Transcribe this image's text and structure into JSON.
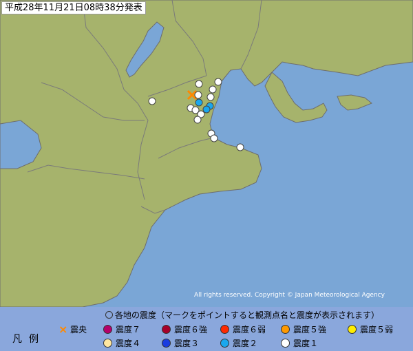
{
  "header": {
    "issued": "平成28年11月21日08時38分発表"
  },
  "copyright": "All rights reserved. Copyright © Japan Meteorological Agency",
  "legend": {
    "title": "各地の震度（マークをポイントすると観測点名と震度が表示されます）",
    "heading": "凡例",
    "epicenter_label": "震央",
    "items": [
      {
        "label": "震度７",
        "color": "#b5006a"
      },
      {
        "label": "震度６強",
        "color": "#a6002a"
      },
      {
        "label": "震度６弱",
        "color": "#ff2a00"
      },
      {
        "label": "震度５強",
        "color": "#ff9900"
      },
      {
        "label": "震度５弱",
        "color": "#ffee00"
      },
      {
        "label": "震度４",
        "color": "#ffe7a0"
      },
      {
        "label": "震度３",
        "color": "#1a3de0"
      },
      {
        "label": "震度２",
        "color": "#1aa7ee"
      },
      {
        "label": "震度１",
        "color": "#ffffff"
      }
    ]
  },
  "colors": {
    "sea": "#7aa6d6",
    "land": "#a6b36c",
    "border": "#6d6d6d"
  }
}
